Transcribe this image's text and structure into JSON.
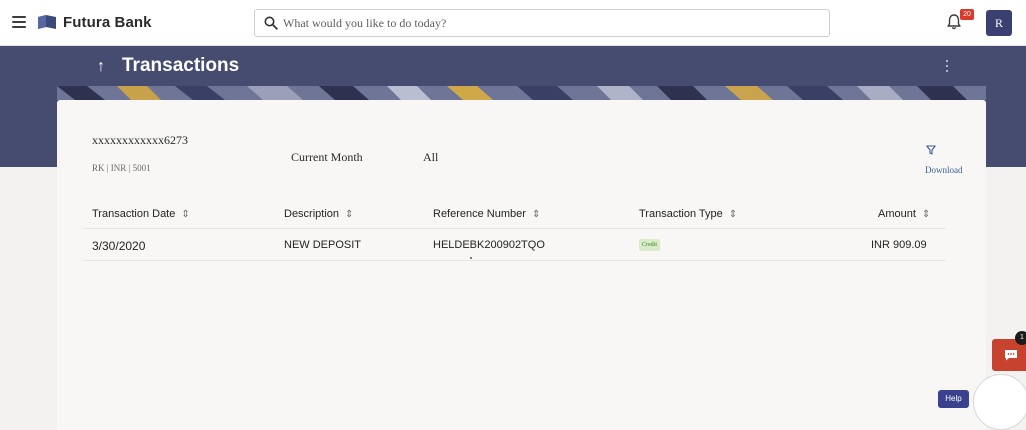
{
  "header": {
    "brand": "Futura Bank",
    "search_placeholder": "What would you like to do today?",
    "notification_count": "20",
    "avatar_initial": "R"
  },
  "page": {
    "title": "Transactions",
    "back_arrow": "↑"
  },
  "account": {
    "number": "xxxxxxxxxxxx6273",
    "meta": "RK | INR | 5001",
    "period": "Current Month",
    "filter": "All",
    "download_label": "Download"
  },
  "table": {
    "columns": [
      "Transaction Date",
      "Description",
      "Reference Number",
      "Transaction Type",
      "Amount"
    ],
    "sort_glyph": "⇕",
    "rows": [
      {
        "date": "3/30/2020",
        "description": "NEW DEPOSIT",
        "reference": "HELDEBK200902TQO",
        "type": "Credit",
        "amount": "INR 909.09"
      }
    ]
  },
  "widgets": {
    "chat_badge": "1",
    "help_label": "Help"
  },
  "colors": {
    "banner": "#464b70",
    "credit_badge_bg": "#d8ecc8",
    "credit_badge_text": "#3f7d2b",
    "chat": "#c8432e",
    "help": "#3a418f",
    "notification": "#d93a2b"
  }
}
